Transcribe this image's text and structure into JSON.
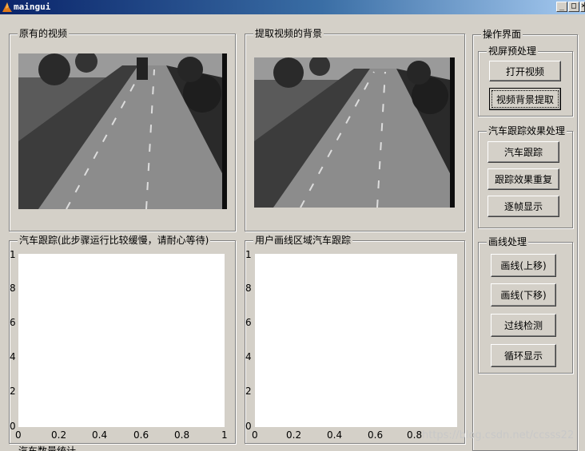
{
  "window": {
    "title": "maingui",
    "controls": [
      "_",
      "□",
      "×"
    ]
  },
  "panels": {
    "original_video": {
      "title": "原有的视频"
    },
    "background": {
      "title": "提取视频的背景"
    },
    "tracking": {
      "title": "汽车跟踪(此步骤运行比较缓慢，请耐心等待)"
    },
    "region_tracking": {
      "title": "用户画线区域汽车跟踪"
    },
    "statistics": {
      "title": "汽车数量统计"
    }
  },
  "operations": {
    "title": "操作界面",
    "preprocess": {
      "title": "视屏预处理",
      "open_video": "打开视频",
      "extract_background": "视频背景提取"
    },
    "tracking_effects": {
      "title": "汽车跟踪效果处理",
      "track_cars": "汽车跟踪",
      "replay_effect": "跟踪效果重复",
      "frame_by_frame": "逐帧显示"
    },
    "line_drawing": {
      "title": "画线处理",
      "line_up": "画线(上移)",
      "line_down": "画线(下移)",
      "crossing_detection": "过线检测",
      "loop_display": "循环显示"
    }
  },
  "axes": {
    "yticks": [
      "1",
      "8",
      "6",
      "4",
      "2",
      "0"
    ],
    "xticks": [
      "0",
      "0.2",
      "0.4",
      "0.6",
      "0.8",
      "1"
    ]
  },
  "watermark": "https://blog.csdn.net/ccsss22"
}
